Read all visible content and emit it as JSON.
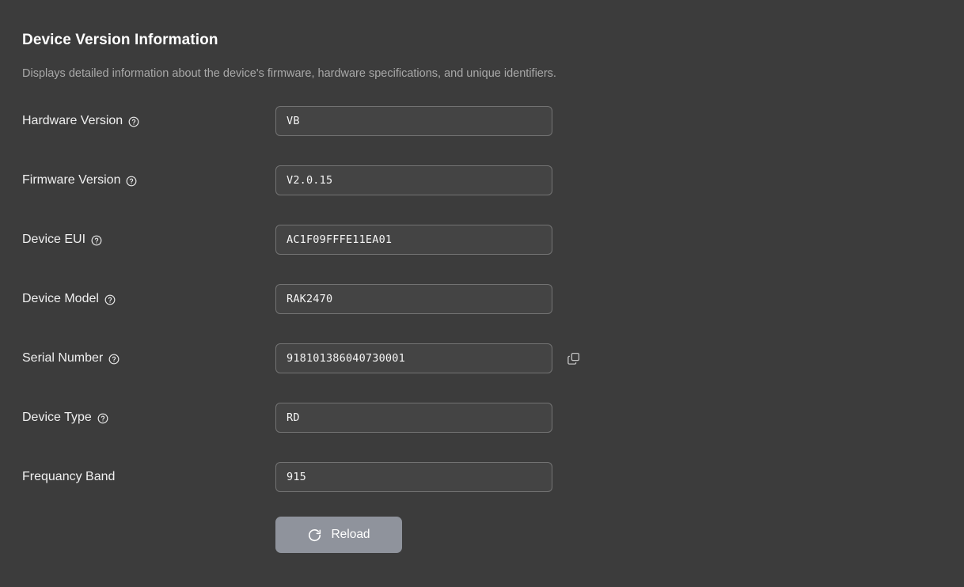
{
  "header": {
    "title": "Device Version Information",
    "subtitle": "Displays detailed information about the device's firmware, hardware specifications, and unique identifiers."
  },
  "icons": {
    "help": "help-circle-icon",
    "copy": "copy-icon",
    "reload": "refresh-icon"
  },
  "fields": [
    {
      "label": "Hardware Version",
      "value": "VB",
      "placeholder": "",
      "has_help": true,
      "has_copy": false
    },
    {
      "label": "Firmware Version",
      "value": "V2.0.15",
      "placeholder": "",
      "has_help": true,
      "has_copy": false
    },
    {
      "label": "Device EUI",
      "value": "AC1F09FFFE11EA01",
      "placeholder": "",
      "has_help": true,
      "has_copy": false
    },
    {
      "label": "Device Model",
      "value": "RAK2470",
      "placeholder": "",
      "has_help": true,
      "has_copy": false
    },
    {
      "label": "Serial Number",
      "value": "918101386040730001",
      "placeholder": "",
      "has_help": true,
      "has_copy": true
    },
    {
      "label": "Device Type",
      "value": "RD",
      "placeholder": "",
      "has_help": true,
      "has_copy": false
    },
    {
      "label": "Frequancy Band",
      "value": "915",
      "placeholder": "",
      "has_help": false,
      "has_copy": false
    }
  ],
  "actions": {
    "reload_label": "Reload"
  },
  "colors": {
    "background": "#3c3c3c",
    "input_background": "#444444",
    "input_border": "#737373",
    "text_primary": "#f0f0f0",
    "text_muted": "#a9a9a9",
    "button": "#8f939c"
  }
}
